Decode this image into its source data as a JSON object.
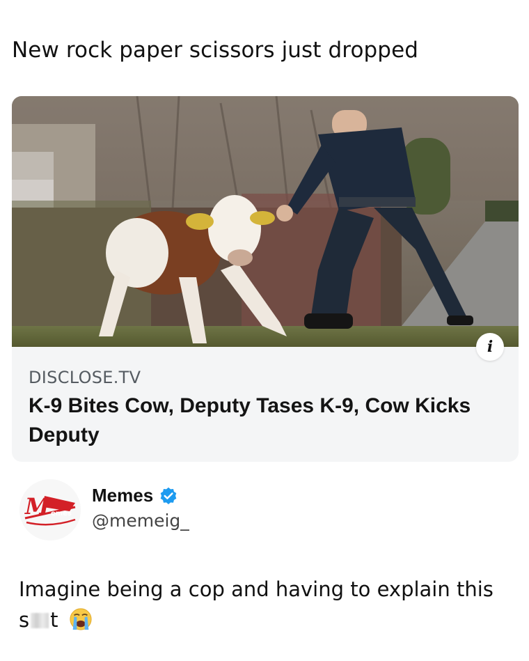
{
  "post": {
    "caption": "New rock paper scissors just dropped"
  },
  "card": {
    "source": "DISCLOSE.TV",
    "headline": "K-9 Bites Cow, Deputy Tases K-9, Cow Kicks Deputy",
    "info_icon": "info-icon",
    "image": "cow-and-police-officer-photo"
  },
  "account": {
    "display_name": "Memes",
    "handle": "@memeig_",
    "verified_icon": "verified-badge-icon",
    "avatar": "memes-logo",
    "avatar_lettering": "Memes",
    "brand_color": "#d32027",
    "verified_color": "#1d9bf0"
  },
  "comment": {
    "text_start": "Imagine being a cop and having to explain this",
    "text_word_start": "s",
    "text_word_end": "t",
    "emoji": "loudly-crying-face-emoji"
  }
}
